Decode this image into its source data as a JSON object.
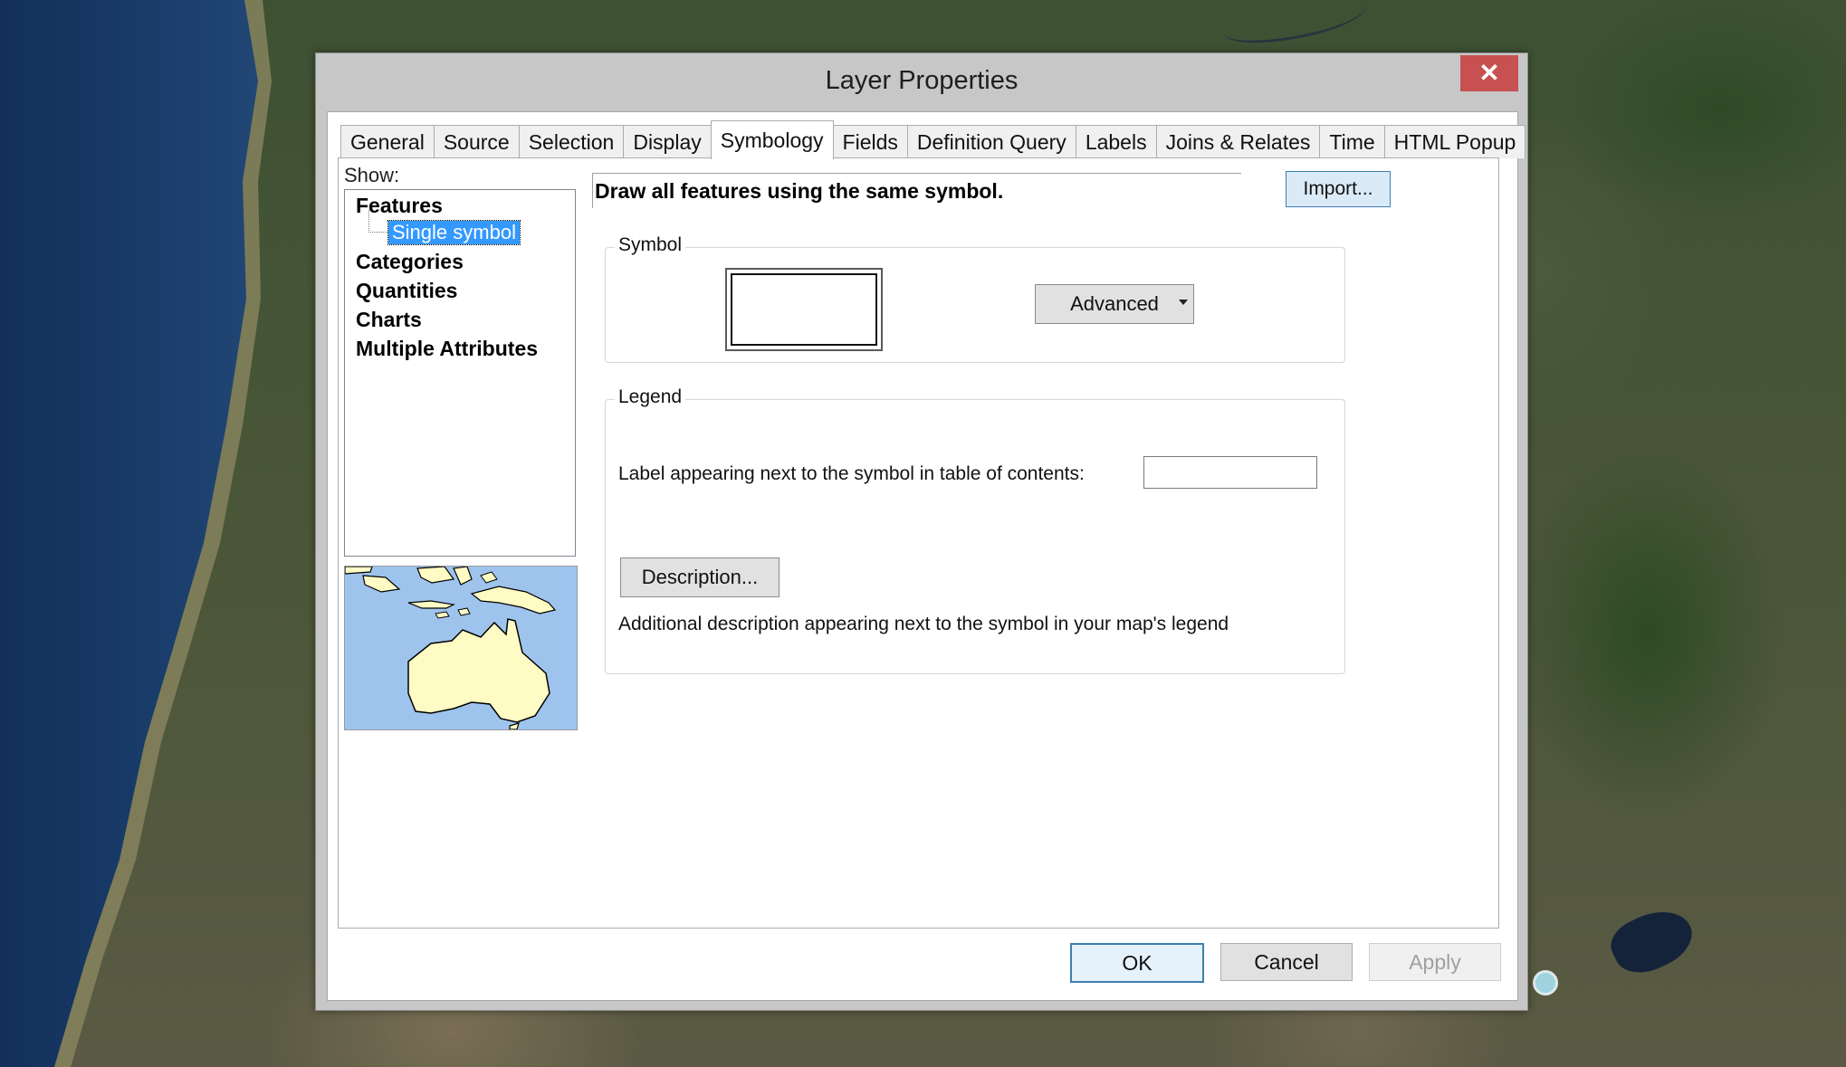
{
  "window": {
    "title": "Layer Properties",
    "close_glyph": "✕"
  },
  "tabs": [
    {
      "label": "General"
    },
    {
      "label": "Source"
    },
    {
      "label": "Selection"
    },
    {
      "label": "Display"
    },
    {
      "label": "Symbology",
      "active": true
    },
    {
      "label": "Fields"
    },
    {
      "label": "Definition Query"
    },
    {
      "label": "Labels"
    },
    {
      "label": "Joins & Relates"
    },
    {
      "label": "Time"
    },
    {
      "label": "HTML Popup"
    }
  ],
  "show": {
    "label": "Show:",
    "items": [
      "Features",
      "Single symbol",
      "Categories",
      "Quantities",
      "Charts",
      "Multiple Attributes"
    ],
    "selected": "Single symbol"
  },
  "symbology": {
    "description": "Draw all features using the same symbol.",
    "import_label": "Import...",
    "symbol_group": "Symbol",
    "advanced_label": "Advanced",
    "legend_group": "Legend",
    "legend_label_text": "Label appearing next to the symbol in table of contents:",
    "legend_label_value": "",
    "description_button": "Description...",
    "description_help": "Additional description appearing next to the symbol in your map's legend"
  },
  "buttons": {
    "ok": "OK",
    "cancel": "Cancel",
    "apply": "Apply"
  },
  "colors": {
    "selection": "#3399ff",
    "close_button": "#c75050",
    "preview_water": "#9ec4ee",
    "preview_land": "#fffbc4"
  },
  "icons": [
    "close-icon",
    "dropdown-arrow-icon",
    "tree-connector-icon"
  ]
}
